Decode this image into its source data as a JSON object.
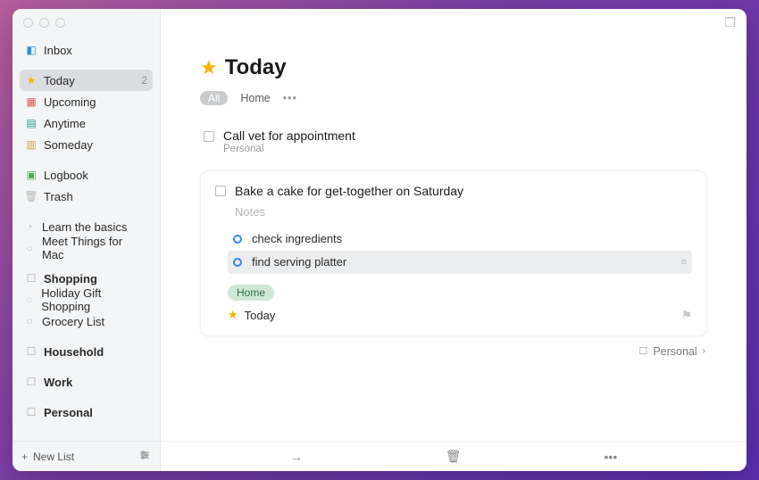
{
  "sidebar": {
    "inbox": "Inbox",
    "today": "Today",
    "today_count": "2",
    "upcoming": "Upcoming",
    "anytime": "Anytime",
    "someday": "Someday",
    "logbook": "Logbook",
    "trash": "Trash",
    "learn": "Learn the basics",
    "meet": "Meet Things for Mac",
    "shopping": "Shopping",
    "holiday": "Holiday Gift Shopping",
    "grocery": "Grocery List",
    "household": "Household",
    "work": "Work",
    "personal": "Personal",
    "new_list": "New List"
  },
  "header": {
    "title": "Today",
    "filter_all": "All",
    "filter_home": "Home"
  },
  "task1": {
    "title": "Call vet for appointment",
    "sub": "Personal"
  },
  "card": {
    "title": "Bake a cake for get-together on Saturday",
    "notes_placeholder": "Notes",
    "check1": "check ingredients",
    "check2": "find serving platter",
    "tag": "Home",
    "when": "Today"
  },
  "area_link": {
    "label": "Personal"
  }
}
